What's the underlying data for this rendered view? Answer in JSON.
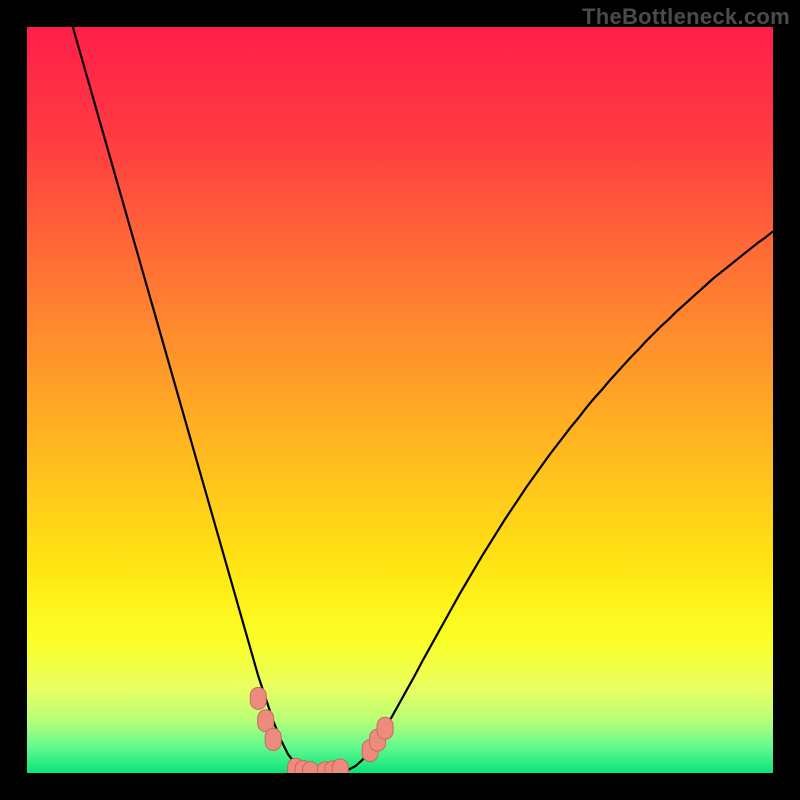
{
  "watermark": "TheBottleneck.com",
  "colors": {
    "frame": "#000000",
    "gradient_stops": [
      {
        "offset": 0.0,
        "color": "#ff1f4a"
      },
      {
        "offset": 0.15,
        "color": "#ff3b42"
      },
      {
        "offset": 0.35,
        "color": "#ff7a33"
      },
      {
        "offset": 0.55,
        "color": "#ffb421"
      },
      {
        "offset": 0.72,
        "color": "#ffe413"
      },
      {
        "offset": 0.82,
        "color": "#fbff25"
      },
      {
        "offset": 0.885,
        "color": "#eaff60"
      },
      {
        "offset": 0.93,
        "color": "#b6ff78"
      },
      {
        "offset": 0.965,
        "color": "#63f98f"
      },
      {
        "offset": 1.0,
        "color": "#08e47a"
      }
    ],
    "curve_stroke": "#000000",
    "marker_fill": "#ed8b7f",
    "marker_stroke": "#c96a5e"
  },
  "chart_data": {
    "type": "line",
    "title": "",
    "xlabel": "",
    "ylabel": "",
    "xlim": [
      0,
      100
    ],
    "ylim": [
      0,
      100
    ],
    "x": [
      5,
      6,
      7,
      8,
      9,
      10,
      11,
      12,
      13,
      14,
      15,
      16,
      17,
      18,
      19,
      20,
      21,
      22,
      23,
      24,
      25,
      26,
      27,
      28,
      29,
      30,
      31,
      32,
      33,
      34,
      35,
      36,
      37,
      38,
      39,
      40,
      41,
      42,
      43,
      44,
      45,
      46,
      47,
      48,
      49,
      50,
      51,
      52,
      53,
      54,
      55,
      56,
      57,
      58,
      59,
      60,
      61,
      62,
      63,
      64,
      65,
      66,
      67,
      68,
      69,
      70,
      71,
      72,
      73,
      74,
      75,
      76,
      77,
      78,
      79,
      80,
      81,
      82,
      83,
      84,
      85,
      86,
      87,
      88,
      89,
      90,
      91,
      92,
      93,
      94,
      95,
      96,
      97,
      98,
      99,
      100
    ],
    "values": [
      104.0,
      100.5,
      97.0,
      93.5,
      90.0,
      86.5,
      83.0,
      79.5,
      76.0,
      72.5,
      69.0,
      65.5,
      62.0,
      58.5,
      55.0,
      51.5,
      48.0,
      44.5,
      41.0,
      37.5,
      34.0,
      30.5,
      27.0,
      23.5,
      20.0,
      16.5,
      13.0,
      10.0,
      7.0,
      4.5,
      2.5,
      1.2,
      0.5,
      0.2,
      0.05,
      0.0,
      0.05,
      0.15,
      0.4,
      0.9,
      1.8,
      3.0,
      4.4,
      6.0,
      7.7,
      9.5,
      11.3,
      13.1,
      15.0,
      16.8,
      18.6,
      20.4,
      22.2,
      24.0,
      25.7,
      27.4,
      29.1,
      30.7,
      32.3,
      33.9,
      35.4,
      36.9,
      38.4,
      39.8,
      41.2,
      42.6,
      43.9,
      45.2,
      46.5,
      47.7,
      49.0,
      50.2,
      51.3,
      52.5,
      53.6,
      54.7,
      55.8,
      56.8,
      57.9,
      58.9,
      59.9,
      60.8,
      61.8,
      62.7,
      63.6,
      64.5,
      65.4,
      66.3,
      67.1,
      67.9,
      68.7,
      69.5,
      70.3,
      71.1,
      71.8,
      72.6
    ],
    "x_markers": [
      31,
      32,
      33,
      36,
      37,
      38,
      40,
      41,
      42,
      46,
      47,
      48
    ],
    "y_markers": [
      10.0,
      7.0,
      4.5,
      0.5,
      0.2,
      0.05,
      0.05,
      0.15,
      0.4,
      3.0,
      4.4,
      6.0
    ],
    "note": "Two thin black curves forming a sharp V-shaped dip on a vertical rainbow gradient background. Coral-colored markers cluster around the minimum of the dip. No visible axis ticks, gridlines, or legend."
  }
}
